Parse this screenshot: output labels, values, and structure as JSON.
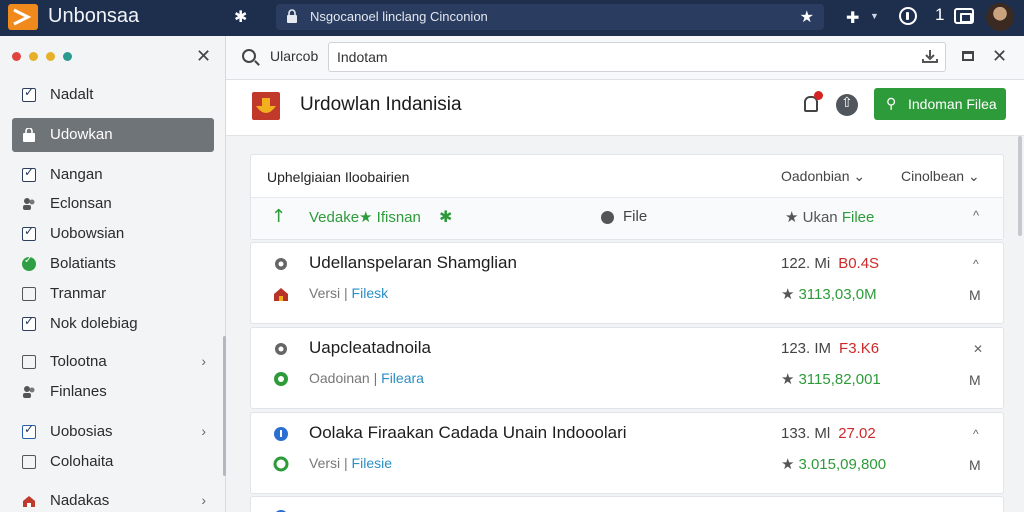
{
  "app": {
    "title": "Unbonsaa",
    "url": "Nsgocanoel linclang Cinconion",
    "tab_count": "1"
  },
  "sidebar": {
    "items": [
      {
        "label": "Nadalt",
        "icon": "checkbox-icon"
      },
      {
        "label": "Udowkan",
        "icon": "file-lock-icon",
        "active": true
      },
      {
        "label": "Nangan",
        "icon": "checkbox-checked-icon"
      },
      {
        "label": "Eclonsan",
        "icon": "people-icon"
      },
      {
        "label": "Uobowsian",
        "icon": "checkbox-checked-icon"
      },
      {
        "label": "Bolatiants",
        "icon": "check-circle-icon"
      },
      {
        "label": "Tranmar",
        "icon": "box-icon"
      },
      {
        "label": "Nok dolebiag",
        "icon": "checkbox-checked-icon"
      },
      {
        "label": "Tolootna",
        "icon": "box-icon",
        "chevron": "›"
      },
      {
        "label": "Finlanes",
        "icon": "people-icon"
      },
      {
        "label": "Uobosias",
        "icon": "checkbox-blue-icon",
        "chevron": "›"
      },
      {
        "label": "Colohaita",
        "icon": "box-icon"
      },
      {
        "label": "Nadakas",
        "icon": "house-icon",
        "chevron": "›"
      }
    ]
  },
  "toolbar": {
    "search_label": "Ularcob",
    "search_value": "Indotam"
  },
  "header": {
    "title": "Urdowlan Indanisia",
    "upload_label": "Indoman Filea"
  },
  "list": {
    "title": "Uphelgiaian Iloobairien",
    "dropdown1": "Oadonbian",
    "dropdown2": "Cinolbean",
    "sub": {
      "title": "Vedake★ Ifisnan",
      "file_label": "File",
      "sort_prefix": "Ukan",
      "sort_accent": "Filee"
    },
    "files": [
      {
        "title": "Udellanspelaran Shamglian",
        "sub_text": "Versi",
        "sub_link": "Filesk",
        "size": "122. Mi",
        "size_accent": "B0.4S",
        "amount": "3113,03,0M",
        "m_label": "M"
      },
      {
        "title": "Uapcleatadnoila",
        "sub_text": "Oadoinan",
        "sub_link": "Fileara",
        "size": "123. IM",
        "size_accent": "F3.K6",
        "amount": "3115,82,001",
        "m_label": "M"
      },
      {
        "title": "Oolaka Firaakan Cadada Unain Indooolari",
        "sub_text": "Versi",
        "sub_link": "Filesie",
        "size": "133. Ml",
        "size_accent": "27.02",
        "amount": "3.015,09,800",
        "m_label": "M"
      }
    ]
  },
  "colors": {
    "topbar": "#1d2f4d",
    "accent_green": "#2e9b3a",
    "accent_red": "#cc2a2a",
    "link_blue": "#2a8fc4"
  }
}
